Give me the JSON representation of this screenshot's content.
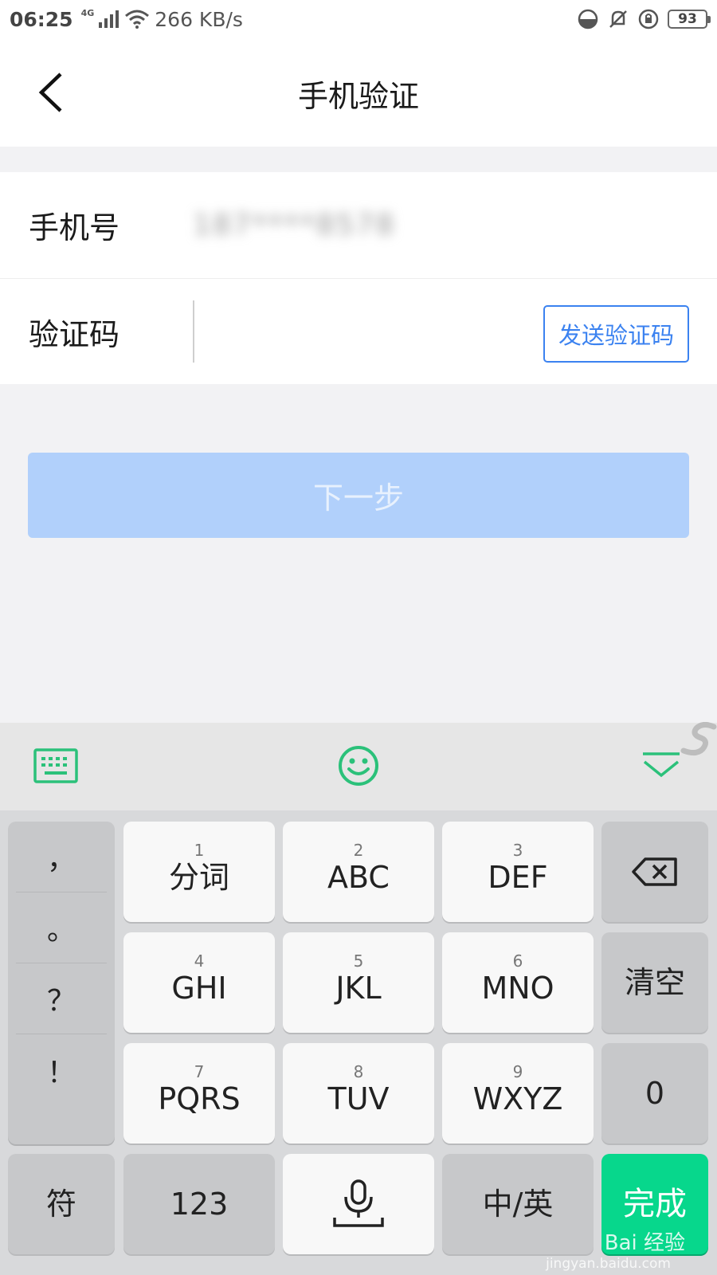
{
  "status_bar": {
    "time": "06:25",
    "network": "4G",
    "speed": "266 KB/s",
    "battery": "93"
  },
  "header": {
    "title": "手机验证",
    "back_icon": "chevron-left-icon"
  },
  "form": {
    "phone_label": "手机号",
    "phone_value": "187****8578",
    "code_label": "验证码",
    "code_value": "",
    "send_code_label": "发送验证码"
  },
  "next_button_label": "下一步",
  "keyboard": {
    "toolbar_icons": [
      "keyboard-icon",
      "emoji-icon",
      "collapse-keyboard-icon"
    ],
    "punctuation": [
      "，",
      "。",
      "？",
      "！"
    ],
    "keys": [
      {
        "num": "1",
        "label": "分词"
      },
      {
        "num": "2",
        "label": "ABC"
      },
      {
        "num": "3",
        "label": "DEF"
      },
      {
        "num": "4",
        "label": "GHI"
      },
      {
        "num": "5",
        "label": "JKL"
      },
      {
        "num": "6",
        "label": "MNO"
      },
      {
        "num": "7",
        "label": "PQRS"
      },
      {
        "num": "8",
        "label": "TUV"
      },
      {
        "num": "9",
        "label": "WXYZ"
      }
    ],
    "clear_label": "清空",
    "zero_label": "0",
    "symbol_label": "符",
    "num_label": "123",
    "lang_label": "中/英",
    "done_label": "完成"
  },
  "watermark": {
    "main": "Bai 经验",
    "sub": "jingyan.baidu.com"
  },
  "colors": {
    "accent_blue": "#3b82f0",
    "next_button_disabled": "#b1d0fb",
    "keyboard_green": "#2bc17a",
    "done_green": "#07d78c"
  }
}
